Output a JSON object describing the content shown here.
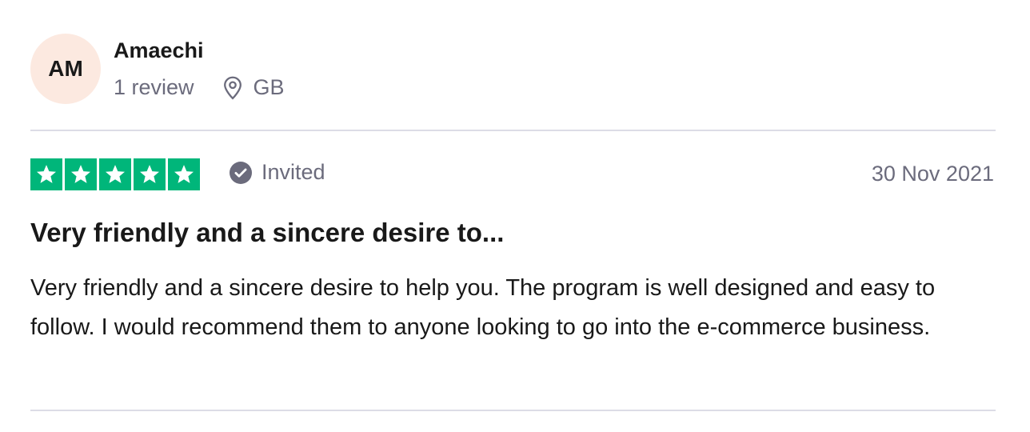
{
  "reviewer": {
    "initials": "AM",
    "name": "Amaechi",
    "review_count": "1 review",
    "location": "GB",
    "location_icon": "location-pin-icon"
  },
  "rating": {
    "stars": 5,
    "max_stars": 5,
    "star_color": "#00b67a",
    "status_label": "Invited",
    "status_icon": "check-circle-icon"
  },
  "review": {
    "date": "30 Nov 2021",
    "title": "Very friendly and a sincere desire to...",
    "body": "Very friendly and a sincere desire to help you. The program is well designed and easy to follow. I would recommend them to anyone looking to go into the e-commerce business."
  },
  "colors": {
    "avatar_bg": "#fce9e0",
    "muted_text": "#6b6b7c",
    "divider": "#dcdce6"
  }
}
